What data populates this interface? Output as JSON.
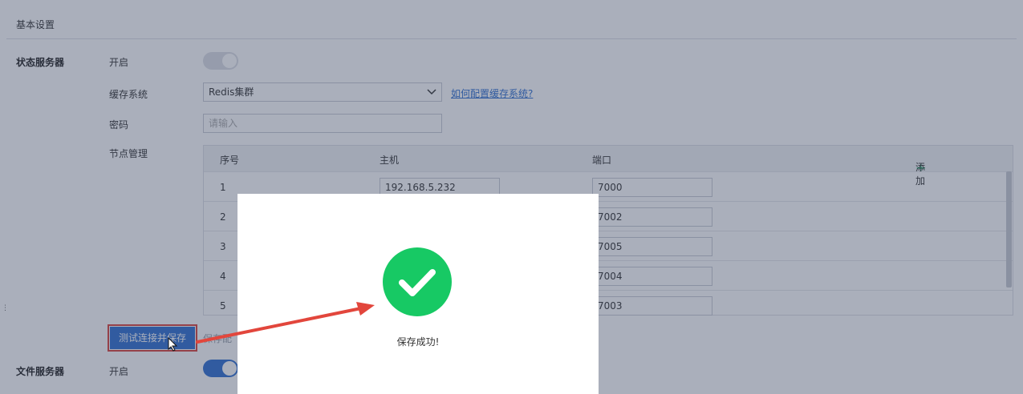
{
  "section": {
    "title": "基本设置"
  },
  "state_server": {
    "group_title": "状态服务器",
    "enable_label": "开启",
    "cache_label": "缓存系统",
    "cache_value": "Redis集群",
    "help_link": "如何配置缓存系统?",
    "password_label": "密码",
    "password_placeholder": "请输入",
    "nodes_label": "节点管理",
    "table": {
      "headers": {
        "seq": "序号",
        "host": "主机",
        "port": "端口"
      },
      "add_label": "添加",
      "rows": [
        {
          "seq": "1",
          "host": "192.168.5.232",
          "port": "7000"
        },
        {
          "seq": "2",
          "host": "",
          "port": "7002"
        },
        {
          "seq": "3",
          "host": "",
          "port": "7005"
        },
        {
          "seq": "4",
          "host": "",
          "port": "7004"
        },
        {
          "seq": "5",
          "host": "",
          "port": "7003"
        }
      ]
    },
    "save_button": "测试连接并保存",
    "after_button_text": "保存配"
  },
  "file_server": {
    "group_title": "文件服务器",
    "enable_label": "开启"
  },
  "modal": {
    "message": "保存成功!"
  },
  "colors": {
    "primary": "#2f6fd0",
    "success": "#17c964",
    "arrow": "#e2463c"
  },
  "icons": {
    "success": "check-circle-icon",
    "add": "plus-icon",
    "dropdown": "chevron-down-icon",
    "cursor": "mouse-pointer-icon"
  }
}
